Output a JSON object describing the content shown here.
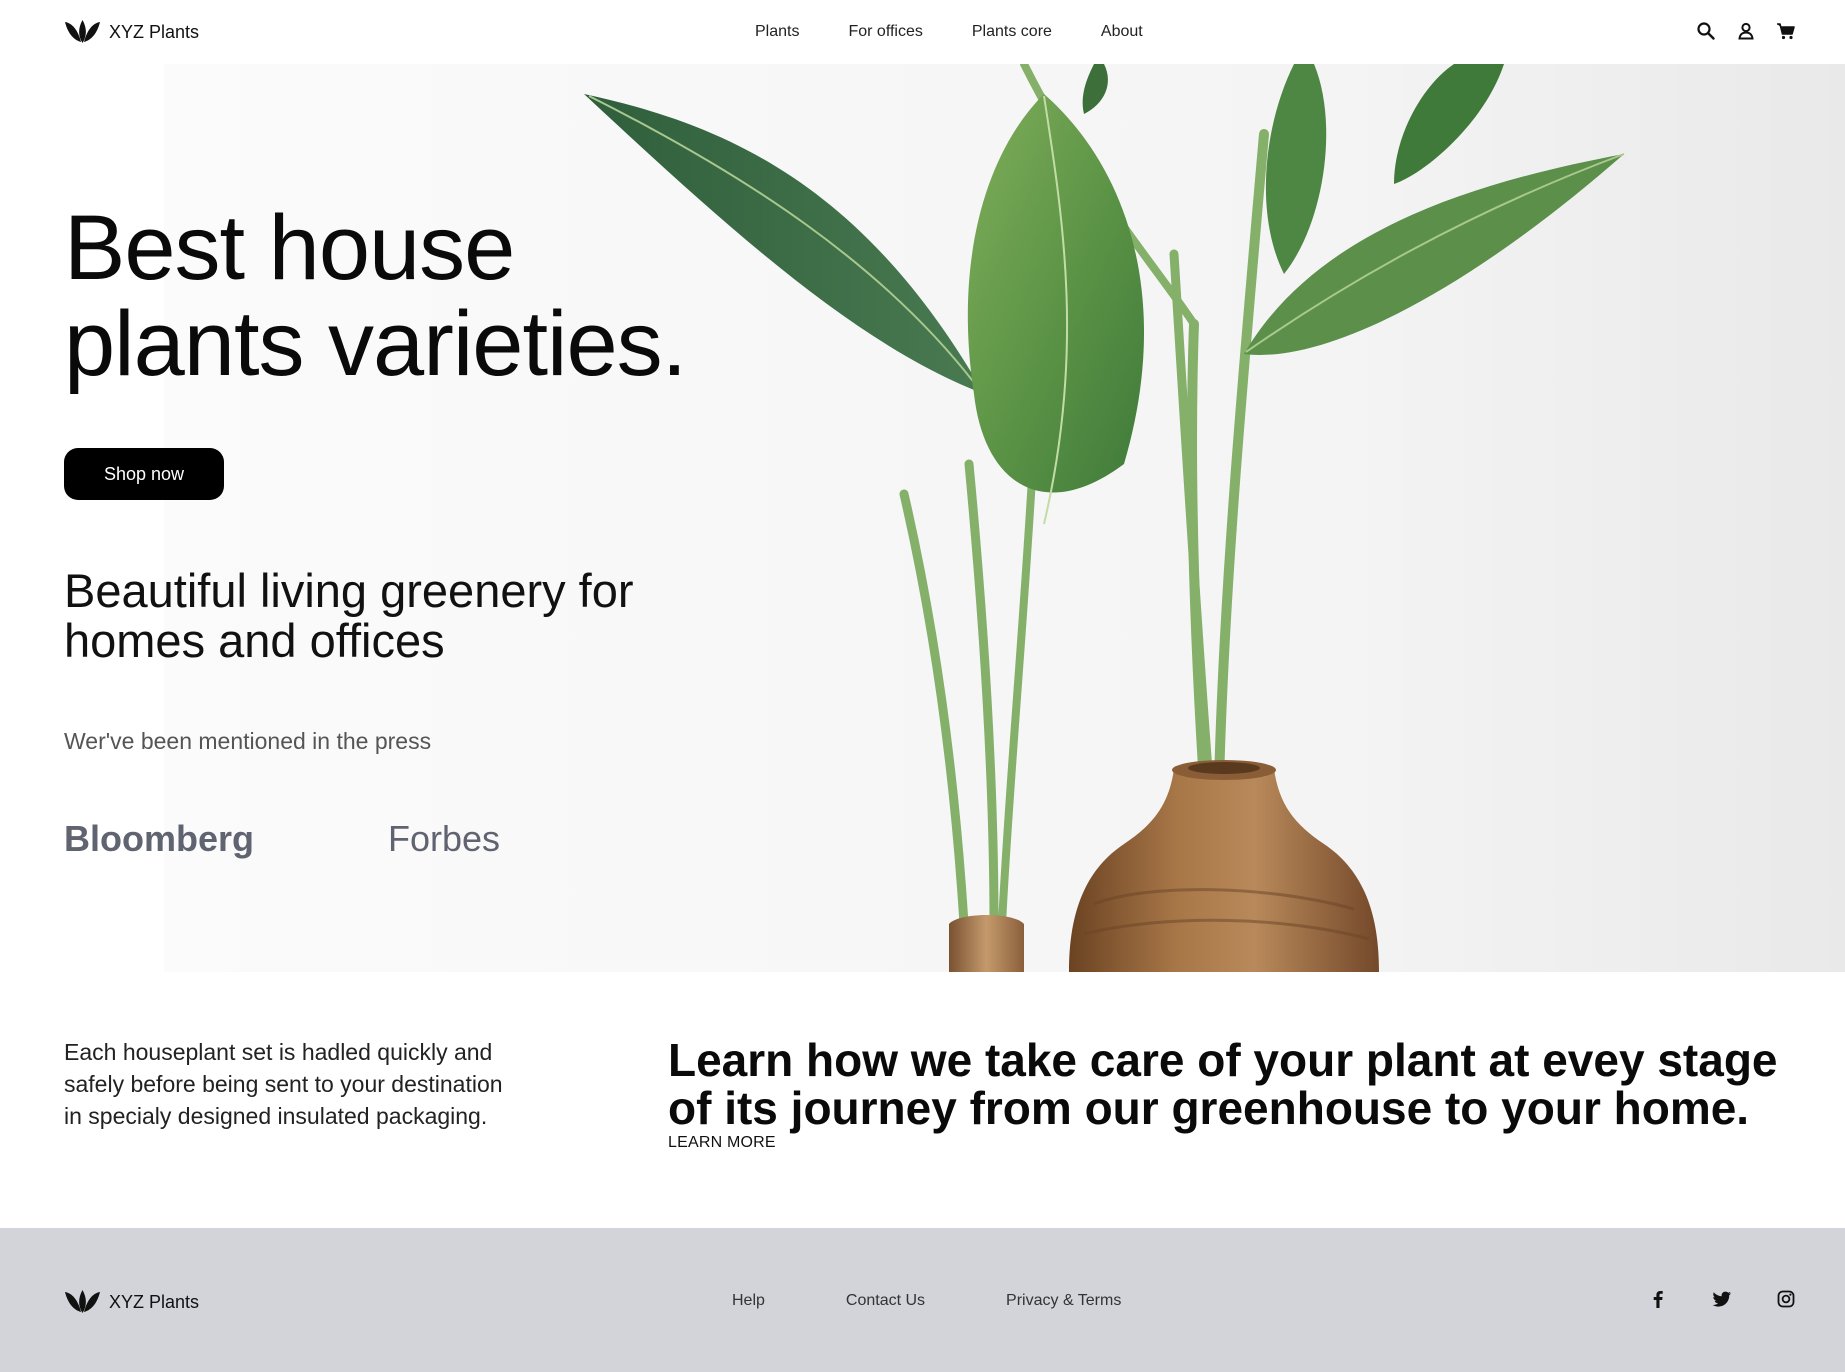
{
  "header": {
    "brand": "XYZ Plants",
    "nav": [
      "Plants",
      "For offices",
      "Plants core",
      "About"
    ],
    "icons": [
      "search-icon",
      "user-icon",
      "cart-icon"
    ]
  },
  "hero": {
    "title_line1": "Best house",
    "title_line2": "plants varieties.",
    "cta": "Shop now",
    "subtitle_line1": "Beautiful living greenery for",
    "subtitle_line2": "homes and offices",
    "press_label": "Wer've been mentioned in the press",
    "press_logos": [
      "Bloomberg",
      "Forbes"
    ]
  },
  "info": {
    "description": "Each houseplant set is hadled quickly and safely before being sent to your destination in specialy designed insulated packaging.",
    "heading": "Learn how we take care of your plant at evey stage of its journey from our greenhouse to your home.",
    "link": "LEARN MORE"
  },
  "footer": {
    "brand": "XYZ Plants",
    "links": [
      "Help",
      "Contact Us",
      "Privacy & Terms"
    ],
    "social": [
      "facebook-icon",
      "twitter-icon",
      "instagram-icon"
    ]
  },
  "colors": {
    "footer_bg": "#d2d4da",
    "button_bg": "#000000",
    "press_logo": "#5f6470"
  }
}
